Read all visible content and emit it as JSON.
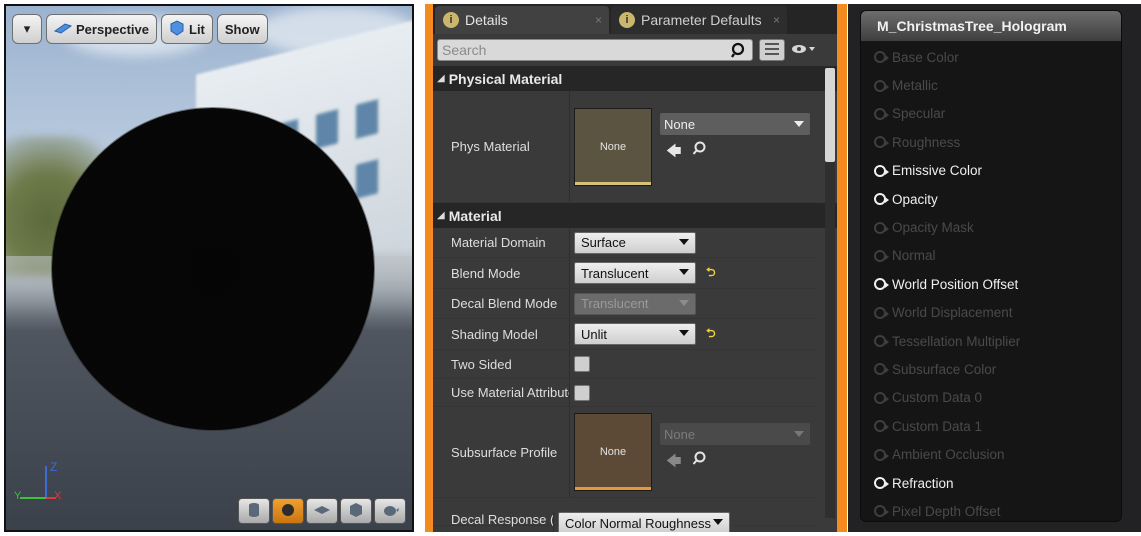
{
  "viewport": {
    "menu_button": "▾",
    "perspective_label": "Perspective",
    "lit_label": "Lit",
    "show_label": "Show",
    "axis": {
      "z": "Z",
      "y": "Y",
      "x": "X"
    }
  },
  "details": {
    "tabs": [
      {
        "label": "Details",
        "icon": "info-icon",
        "close": "×"
      },
      {
        "label": "Parameter Defaults",
        "icon": "info-icon",
        "close": "×"
      }
    ],
    "search": {
      "placeholder": "Search"
    },
    "physical_material": {
      "header": "Physical Material",
      "phys_material_label": "Phys Material",
      "thumb_label": "None",
      "value": "None"
    },
    "material": {
      "header": "Material",
      "rows": [
        {
          "label": "Material Domain",
          "value": "Surface",
          "reset": ""
        },
        {
          "label": "Blend Mode",
          "value": "Translucent",
          "reset": "⮌"
        },
        {
          "label": "Decal Blend Mode",
          "value": "Translucent",
          "reset": ""
        },
        {
          "label": "Shading Model",
          "value": "Unlit",
          "reset": "⮌"
        }
      ],
      "two_sided_label": "Two Sided",
      "use_attr_label": "Use Material Attributes",
      "subsurface_label": "Subsurface Profile",
      "subsurface_thumb": "None",
      "subsurface_value": "None",
      "decal_response_label": "Decal Response (DBuffer)",
      "decal_response_value": "Color Normal Roughness"
    }
  },
  "node": {
    "title": "M_ChristmasTree_Hologram",
    "pins": [
      {
        "label": "Base Color",
        "enabled": false
      },
      {
        "label": "Metallic",
        "enabled": false
      },
      {
        "label": "Specular",
        "enabled": false
      },
      {
        "label": "Roughness",
        "enabled": false
      },
      {
        "label": "Emissive Color",
        "enabled": true
      },
      {
        "label": "Opacity",
        "enabled": true
      },
      {
        "label": "Opacity Mask",
        "enabled": false
      },
      {
        "label": "Normal",
        "enabled": false
      },
      {
        "label": "World Position Offset",
        "enabled": true
      },
      {
        "label": "World Displacement",
        "enabled": false
      },
      {
        "label": "Tessellation Multiplier",
        "enabled": false
      },
      {
        "label": "Subsurface Color",
        "enabled": false
      },
      {
        "label": "Custom Data 0",
        "enabled": false
      },
      {
        "label": "Custom Data 1",
        "enabled": false
      },
      {
        "label": "Ambient Occlusion",
        "enabled": false
      },
      {
        "label": "Refraction",
        "enabled": true
      },
      {
        "label": "Pixel Depth Offset",
        "enabled": false
      }
    ]
  },
  "colors": {
    "accent_orange": "#f58a1f",
    "thumb_physical": "#5b5440",
    "thumb_subsurface": "#5c4a36"
  }
}
